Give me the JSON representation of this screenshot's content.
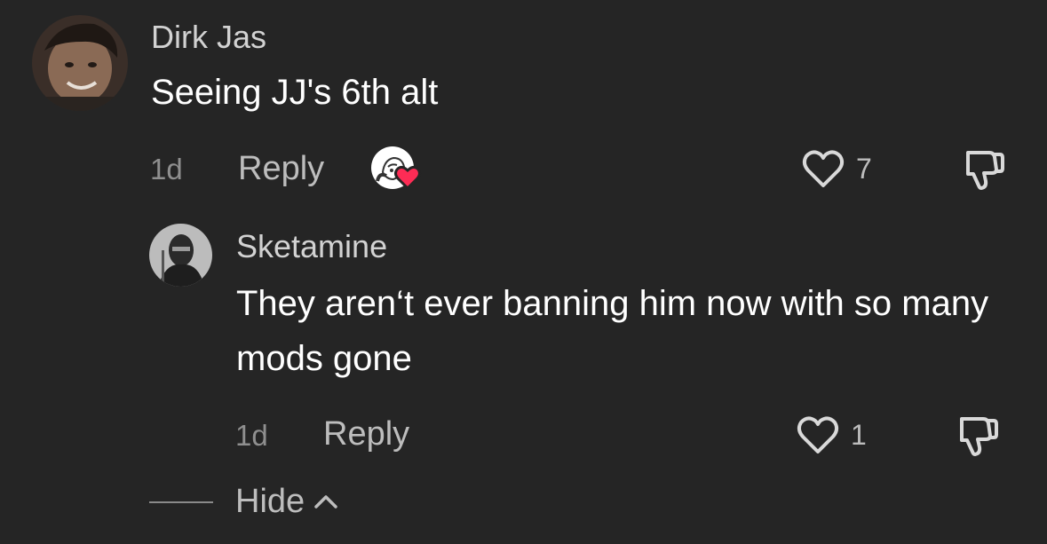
{
  "comments": [
    {
      "username": "Dirk Jas",
      "text": "Seeing JJ's 6th alt",
      "time": "1d",
      "reply_label": "Reply",
      "likes": "7",
      "liked_by_creator": true
    },
    {
      "username": "Sketamine",
      "text": "They aren‘t ever banning him now with so many mods gone",
      "time": "1d",
      "reply_label": "Reply",
      "likes": "1"
    }
  ],
  "thread": {
    "hide_label": "Hide"
  },
  "colors": {
    "background": "#252525",
    "heart_badge": "#fe2c55",
    "text_primary": "#ffffff",
    "text_secondary": "#bdbdbd"
  }
}
